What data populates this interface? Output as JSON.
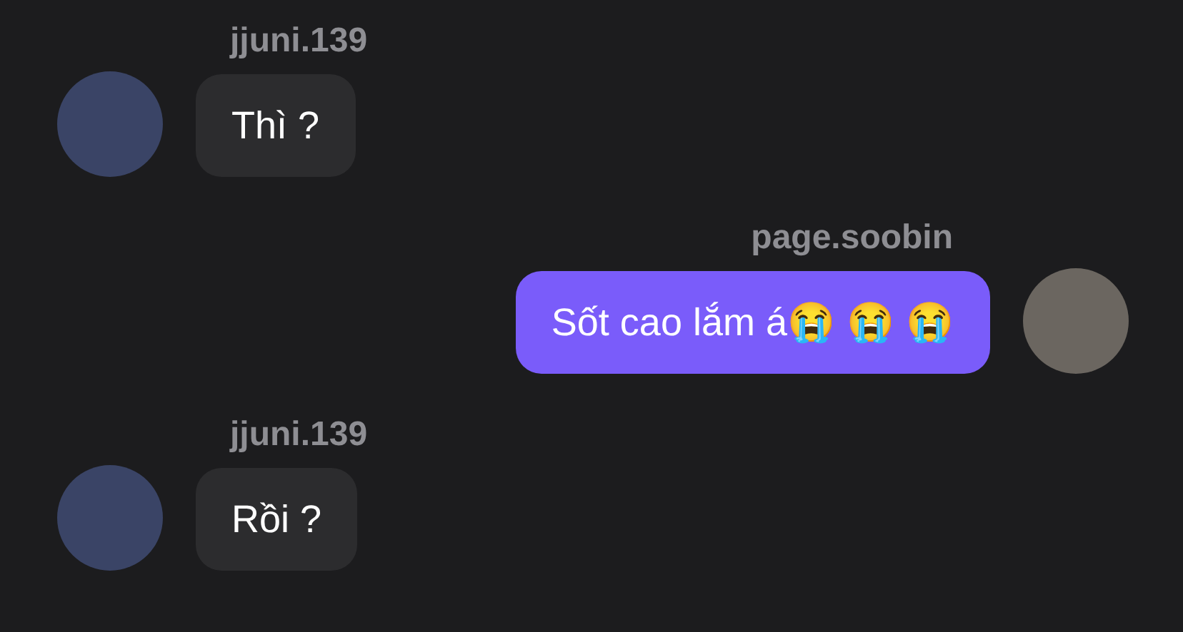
{
  "messages": [
    {
      "kind": "incoming",
      "author": "jjuni.139",
      "text": "Thì ?"
    },
    {
      "kind": "outgoing",
      "author": "page.soobin",
      "text": "Sốt cao lắm á😭 😭 😭"
    },
    {
      "kind": "incoming",
      "author": "jjuni.139",
      "text": "Rồi ?"
    }
  ]
}
